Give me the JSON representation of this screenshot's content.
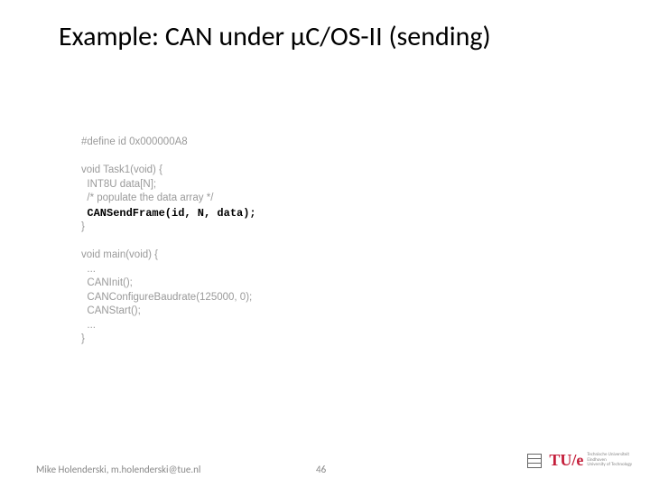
{
  "title": "Example: CAN under μC/OS-II (sending)",
  "code": {
    "l1": "#define id 0x000000A8",
    "l2": "",
    "l3": "void Task1(void) {",
    "l4": "  INT8U data[N];",
    "l5": "  /* populate the data array */",
    "l6a": "  ",
    "l6b": "CANSendFrame(id, N, data);",
    "l7": "}",
    "l8": "",
    "l9": "void main(void) {",
    "l10": "  ...",
    "l11": "  CANInit();",
    "l12": "  CANConfigureBaudrate(125000, 0);",
    "l13": "  CANStart();",
    "l14": "  ...",
    "l15": "}"
  },
  "footer": {
    "author": "Mike Holenderski, m.holenderski@tue.nl",
    "page": "46",
    "logo_text": "TU/e",
    "logo_sub1": "Technische Universiteit",
    "logo_sub2": "Eindhoven",
    "logo_sub3": "University of Technology"
  }
}
